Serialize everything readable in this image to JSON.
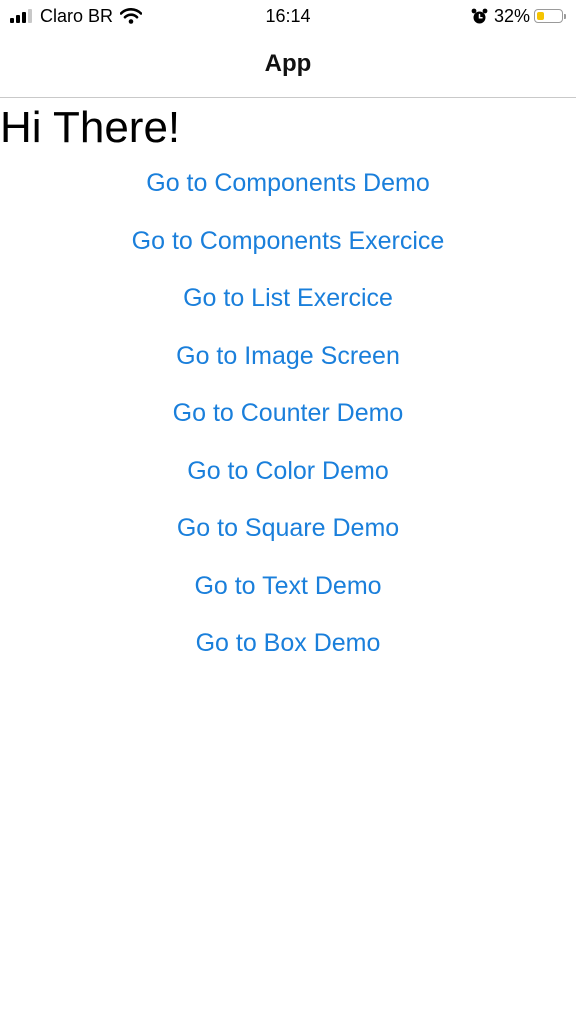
{
  "status_bar": {
    "carrier": "Claro BR",
    "time": "16:14",
    "battery_percent_label": "32%",
    "battery_level": 0.32,
    "battery_color": "#f5c400",
    "icons": [
      "signal-icon",
      "wifi-icon",
      "alarm-icon",
      "battery-icon"
    ]
  },
  "header": {
    "title": "App"
  },
  "main": {
    "greeting": "Hi There!",
    "link_color": "#1a7fdb",
    "links": [
      "Go to Components Demo",
      "Go to Components Exercice",
      "Go to List Exercice",
      "Go to Image Screen",
      "Go to Counter Demo",
      "Go to Color Demo",
      "Go to Square Demo",
      "Go to Text Demo",
      "Go to Box Demo"
    ]
  }
}
